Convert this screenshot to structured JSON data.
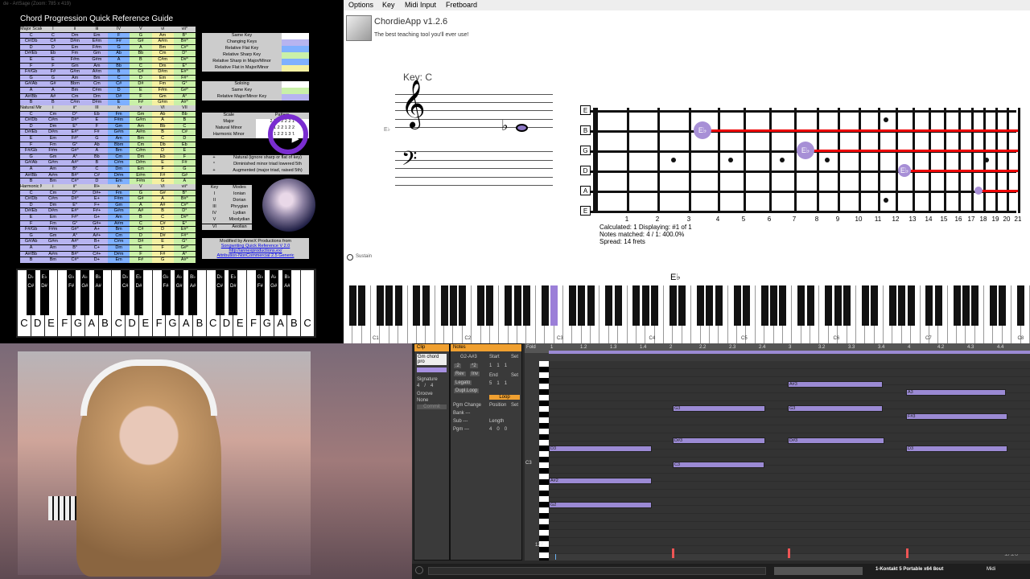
{
  "window_title": "Chord Progression Quick Reference Guide",
  "ref_title": "Chord Progression Quick Reference Guide",
  "zoom_text": "de - ArtSage (Zoom: 785 x 419)",
  "major_header": [
    "Major Scale",
    "I",
    "ii",
    "iii",
    "IV",
    "V",
    "vi",
    "vii°"
  ],
  "major_rows": [
    [
      "C",
      "C",
      "Dm",
      "Em",
      "F",
      "G",
      "Am",
      "B°"
    ],
    [
      "C#/Db",
      "C#",
      "D#m",
      "E#m",
      "F#",
      "G#",
      "A#m",
      "B#°"
    ],
    [
      "D",
      "D",
      "Em",
      "F#m",
      "G",
      "A",
      "Bm",
      "C#°"
    ],
    [
      "D#/Eb",
      "Eb",
      "Fm",
      "Gm",
      "Ab",
      "Bb",
      "Cm",
      "D°"
    ],
    [
      "E",
      "E",
      "F#m",
      "G#m",
      "A",
      "B",
      "C#m",
      "D#°"
    ],
    [
      "F",
      "F",
      "Gm",
      "Am",
      "Bb",
      "C",
      "Dm",
      "E°"
    ],
    [
      "F#/Gb",
      "F#",
      "G#m",
      "A#m",
      "B",
      "C#",
      "D#m",
      "E#°"
    ],
    [
      "G",
      "G",
      "Am",
      "Bm",
      "C",
      "D",
      "Em",
      "F#°"
    ],
    [
      "G#/Ab",
      "G#",
      "Bbm",
      "Cm",
      "C#",
      "D#",
      "Fm",
      "G°"
    ],
    [
      "A",
      "A",
      "Bm",
      "C#m",
      "D",
      "E",
      "F#m",
      "G#°"
    ],
    [
      "A#/Bb",
      "A#",
      "Cm",
      "Dm",
      "D#",
      "F",
      "Gm",
      "A°"
    ],
    [
      "B",
      "B",
      "C#m",
      "D#m",
      "E",
      "F#",
      "G#m",
      "A#°"
    ]
  ],
  "minor_header": [
    "Natural Minor",
    "i",
    "ii°",
    "III",
    "iv",
    "v",
    "VI",
    "VII"
  ],
  "minor_rows": [
    [
      "C",
      "Cm",
      "D°",
      "Eb",
      "Fm",
      "Gm",
      "Ab",
      "Bb"
    ],
    [
      "C#/Db",
      "C#m",
      "D#°",
      "E",
      "F#m",
      "G#m",
      "A",
      "B"
    ],
    [
      "D",
      "Dm",
      "E°",
      "F",
      "Gm",
      "Am",
      "Bb",
      "C"
    ],
    [
      "D#/Eb",
      "D#m",
      "E#°",
      "F#",
      "G#m",
      "A#m",
      "B",
      "C#"
    ],
    [
      "E",
      "Em",
      "F#°",
      "G",
      "Am",
      "Bm",
      "C",
      "D"
    ],
    [
      "F",
      "Fm",
      "G°",
      "Ab",
      "Bbm",
      "Cm",
      "Db",
      "Eb"
    ],
    [
      "F#/Gb",
      "F#m",
      "G#°",
      "A",
      "Bm",
      "C#m",
      "D",
      "E"
    ],
    [
      "G",
      "Gm",
      "A°",
      "Bb",
      "Cm",
      "Dm",
      "Eb",
      "F"
    ],
    [
      "G#/Ab",
      "G#m",
      "A#°",
      "B",
      "C#m",
      "D#m",
      "E",
      "F#"
    ],
    [
      "A",
      "Am",
      "B°",
      "C",
      "Dm",
      "Em",
      "F",
      "G"
    ],
    [
      "A#/Bb",
      "A#m",
      "B#°",
      "C#",
      "D#m",
      "E#m",
      "F#",
      "G#"
    ],
    [
      "B",
      "Bm",
      "C#°",
      "D",
      "Em",
      "F#m",
      "G",
      "A"
    ]
  ],
  "harm_header": [
    "Harmonic Minor",
    "i",
    "ii°",
    "III+",
    "iv",
    "V",
    "VI",
    "vii°"
  ],
  "harm_rows": [
    [
      "C",
      "Cm",
      "D°",
      "D#+",
      "Fm",
      "G",
      "G#",
      "B°"
    ],
    [
      "C#/Db",
      "C#m",
      "D#°",
      "E+",
      "F#m",
      "G#",
      "A",
      "B#°"
    ],
    [
      "D",
      "Dm",
      "E°",
      "F+",
      "Gm",
      "A",
      "A#",
      "C#°"
    ],
    [
      "D#/Eb",
      "D#m",
      "E#°",
      "F#+",
      "G#m",
      "A#",
      "B",
      "D°"
    ],
    [
      "E",
      "Em",
      "F#°",
      "G+",
      "Am",
      "B",
      "C",
      "D#°"
    ],
    [
      "F",
      "Fm",
      "G°",
      "G#+",
      "A#m",
      "C",
      "C#",
      "E°"
    ],
    [
      "F#/Gb",
      "F#m",
      "G#°",
      "A+",
      "Bm",
      "C#",
      "D",
      "E#°"
    ],
    [
      "G",
      "Gm",
      "A°",
      "A#+",
      "Cm",
      "D",
      "D#",
      "F#°"
    ],
    [
      "G#/Ab",
      "G#m",
      "A#°",
      "B+",
      "C#m",
      "D#",
      "E",
      "G°"
    ],
    [
      "A",
      "Am",
      "B°",
      "C+",
      "Dm",
      "E",
      "F",
      "G#°"
    ],
    [
      "A#/Bb",
      "A#m",
      "B#°",
      "C#+",
      "D#m",
      "F",
      "F#",
      "A°"
    ],
    [
      "B",
      "Bm",
      "C#°",
      "D+",
      "Em",
      "F#",
      "G",
      "A#°"
    ]
  ],
  "legend1": [
    {
      "label": "Same Key",
      "color": "#ffffff"
    },
    {
      "label": "Changing Keys",
      "color": "#b7b4f0"
    },
    {
      "label": "Relative Flat Key",
      "color": "#7fb0ff"
    },
    {
      "label": "Relative Sharp Key",
      "color": "#c9f0a8"
    },
    {
      "label": "Relative Sharp in Major/Minor",
      "color": "#7fb0ff"
    },
    {
      "label": "Relative Flat in Major/Minor",
      "color": "#f4f0a2"
    }
  ],
  "legend2": [
    {
      "label": "Soloing",
      "color": "#ffffff"
    },
    {
      "label": "Same Key",
      "color": "#c9f0a8"
    },
    {
      "label": "Relative Major/Minor Key",
      "color": "#b7b4f0"
    }
  ],
  "patterns": {
    "header": [
      "Scale",
      "Pattern"
    ],
    "rows": [
      [
        "Major",
        "2 2 1 2 2 2 1"
      ],
      [
        "Natural Minor",
        "2 1 2 2 1 2 2"
      ],
      [
        "Harmonic Minor",
        "2 1 2 2 1 3 1"
      ]
    ]
  },
  "symbols": [
    [
      "+",
      "Natural (ignore sharp or flat of key)"
    ],
    [
      "°",
      "Diminished minor triad lowered 5th"
    ],
    [
      "+",
      "Augmented (major triad, raised 5th)"
    ]
  ],
  "modes": {
    "header": [
      "Key",
      "Modes"
    ],
    "rows": [
      [
        "I",
        "Ionian"
      ],
      [
        "II",
        "Dorian"
      ],
      [
        "III",
        "Phrygian"
      ],
      [
        "IV",
        "Lydian"
      ],
      [
        "V",
        "Mixolydian"
      ],
      [
        "VI",
        "Aeolian"
      ]
    ]
  },
  "credit": [
    "Modified by AnneX Productions from",
    "Songwriting Quick Reference V 2.0",
    "http://annexproductions.ex/",
    "Attribution-NonCommercial 2.5 Generic"
  ],
  "ref_keyboard": {
    "white": [
      "C",
      "D",
      "E",
      "F",
      "G",
      "A",
      "B",
      "C",
      "D",
      "E",
      "F",
      "G",
      "A",
      "B",
      "C",
      "D",
      "E",
      "F",
      "G",
      "A",
      "B",
      "C"
    ],
    "black": [
      "D♭ C#",
      "E♭ D#",
      "G♭ F#",
      "A♭ G#",
      "B♭ A#",
      "D♭ C#",
      "E♭ D#",
      "G♭ F#",
      "A♭ G#",
      "B♭ A#",
      "D♭ C#",
      "E♭ D#",
      "G♭ F#",
      "A♭ G#",
      "B♭ A#"
    ]
  },
  "menu": [
    "Options",
    "Key",
    "Midi Input",
    "Fretboard"
  ],
  "app_title": "ChordieApp v1.2.6",
  "tagline": "The best teaching tool you'll ever use!",
  "key_label": "Key: C",
  "staff_note": "E♭",
  "sustain": "Sustain",
  "strings": [
    "E",
    "B",
    "G",
    "D",
    "A",
    "E"
  ],
  "frets": [
    "1",
    "2",
    "3",
    "4",
    "5",
    "6",
    "7",
    "8",
    "9",
    "10",
    "11",
    "12",
    "13",
    "14",
    "15",
    "16",
    "17",
    "18",
    "19",
    "20",
    "21"
  ],
  "fret_notes": [
    "E♭",
    "E♭",
    "E♭",
    "E♭"
  ],
  "fb_info": [
    "Calculated: 1   Displaying: #1 of 1",
    "Notes matched: 4 / 1: 400.0%",
    "Spread: 14 frets"
  ],
  "piano_label": "E♭",
  "octaves": [
    "C1",
    "C2",
    "C3",
    "C4",
    "C5",
    "C6",
    "C7",
    "C8"
  ],
  "clip": {
    "title": "Clip",
    "name": "Gm chord pro",
    "sig_label": "Signature",
    "sig": [
      "4",
      "/",
      "4"
    ],
    "groove": "Groove",
    "groove_val": "None",
    "commit": "Commit"
  },
  "notes_panel": {
    "title": "Notes",
    "range": "G2-A#3",
    "start": "Start",
    "set": "Set",
    "start_val": [
      "1",
      "1",
      "1"
    ],
    "end": "End",
    "end_val": [
      "5",
      "1",
      "1"
    ],
    "buttons": [
      ":2",
      "*2",
      "Rev",
      "Inv",
      "Legato",
      "Dupl.Loop"
    ],
    "loop": "Loop",
    "pgm": "Pgm Change",
    "bank": "Bank ---",
    "sub": "Sub ---",
    "pgm_val": "Pgm ---",
    "position": "Position",
    "length": "Length",
    "len_val": [
      "4",
      "0",
      "0"
    ]
  },
  "fold": "Fold",
  "ruler": [
    "1",
    "1.2",
    "1.3",
    "1.4",
    "2",
    "2.2",
    "2.3",
    "2.4",
    "3",
    "3.2",
    "3.3",
    "3.4",
    "4",
    "4.2",
    "4.3",
    "4.4"
  ],
  "midi_notes": [
    "A#3",
    "A3",
    "G3",
    "G3",
    "F#3",
    "D#3",
    "D#3",
    "D3",
    "D3",
    "C3",
    "A#2",
    "G2"
  ],
  "c3_label": "C3",
  "vel": "127",
  "page": "1/16",
  "status_track": "1-Kontakt 5 Portable x64 8out",
  "status_sub": "Midi"
}
